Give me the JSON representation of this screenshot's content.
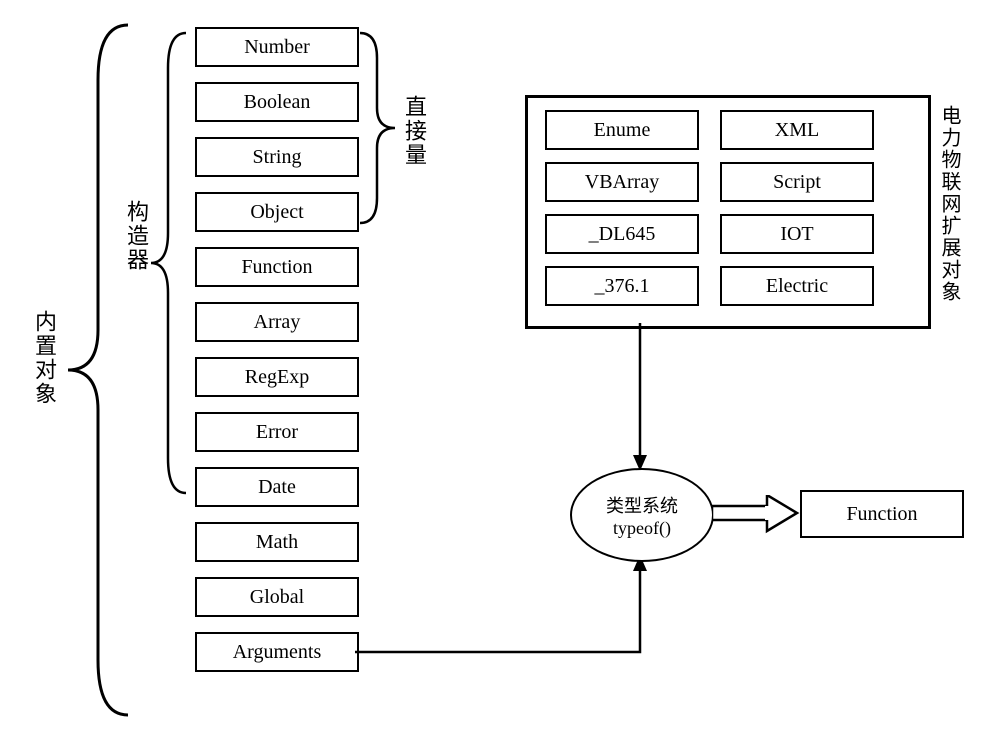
{
  "labels": {
    "builtin": "内置对象",
    "constructor": "构造器",
    "literal": "直接量",
    "extension": "电力物联网扩展对象"
  },
  "builtinItems": [
    "Number",
    "Boolean",
    "String",
    "Object",
    "Function",
    "Array",
    "RegExp",
    "Error",
    "Date",
    "Math",
    "Global",
    "Arguments"
  ],
  "extensionLeft": [
    "Enume",
    "VBArray",
    "_DL645",
    "_376.1"
  ],
  "extensionRight": [
    "XML",
    "Script",
    "IOT",
    "Electric"
  ],
  "typeSystem": {
    "line1": "类型系统",
    "line2": "typeof()"
  },
  "output": "Function"
}
